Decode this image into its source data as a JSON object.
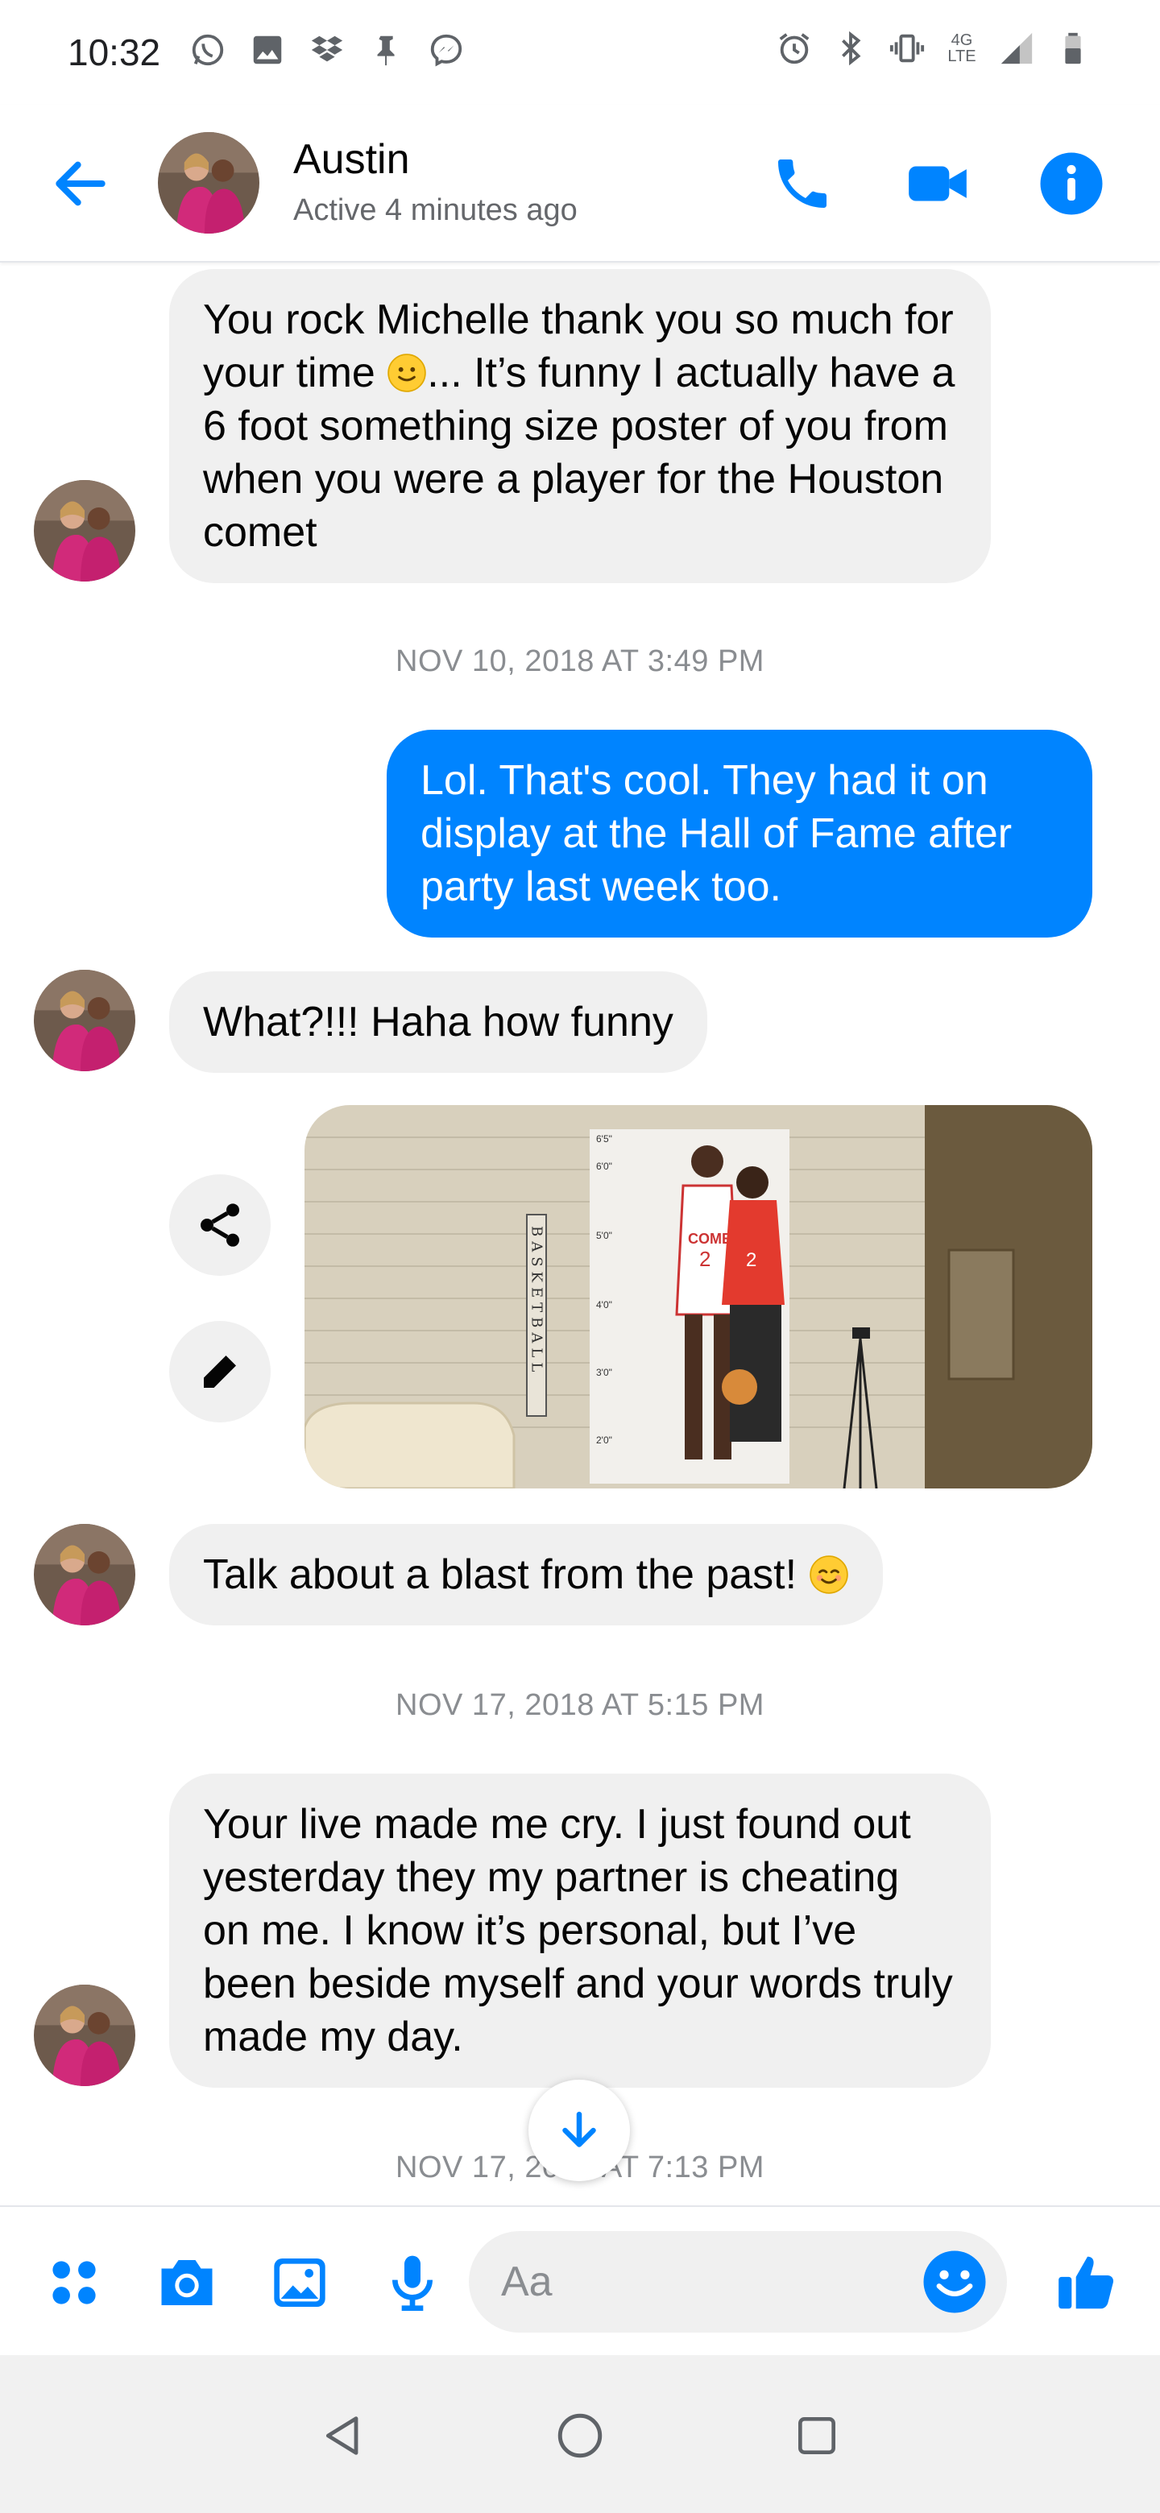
{
  "status_bar": {
    "time": "10:32",
    "left_icons": [
      "whatsapp-icon",
      "image-icon",
      "dropbox-icon",
      "pin-icon",
      "messenger-icon"
    ],
    "right_icons": [
      "alarm-icon",
      "bluetooth-icon",
      "vibrate-icon",
      "network-4g-lte-icon",
      "signal-icon",
      "battery-icon"
    ],
    "network_label_top": "4G",
    "network_label_bottom": "LTE"
  },
  "header": {
    "contact_name": "Austin",
    "status": "Active 4 minutes ago",
    "accent_color": "#0084ff"
  },
  "messages": [
    {
      "type": "incoming",
      "text_before": "You rock Michelle thank you so much for your time ",
      "emoji": "slightly-smiling-face",
      "text_after": "... It’s funny I actually have a 6 foot something size poster of you from when you were a player for the Houston comet"
    },
    {
      "type": "timestamp",
      "text": "NOV 10, 2018 AT 3:49 PM"
    },
    {
      "type": "outgoing",
      "text": "Lol. That's cool. They had it on display at the Hall of Fame after party last week too."
    },
    {
      "type": "incoming",
      "text": "What?!!! Haha how funny"
    },
    {
      "type": "photo",
      "poster_text": "BASKETBALL",
      "height_marks": [
        "6'5\"",
        "6'0\"",
        "5'0\"",
        "4'0\"",
        "3'0\"",
        "2'0\""
      ],
      "jersey_number": "2"
    },
    {
      "type": "incoming",
      "text": "Talk about a blast from the past! ",
      "emoji": "smiling-face-with-smiling-eyes"
    },
    {
      "type": "timestamp",
      "text": "NOV 17, 2018 AT 5:15 PM"
    },
    {
      "type": "incoming",
      "text": "Your live made me cry. I just found out yesterday they my partner is cheating on me. I know it’s personal, but I’ve been beside myself and your words truly made my day."
    },
    {
      "type": "timestamp",
      "text": "NOV 17, 2018 AT 7:13 PM"
    }
  ],
  "composer": {
    "placeholder": "Aa",
    "value": ""
  },
  "colors": {
    "incoming_bubble": "#f0f0f0",
    "outgoing_bubble": "#0084ff",
    "timestamp": "#8a8d91"
  }
}
